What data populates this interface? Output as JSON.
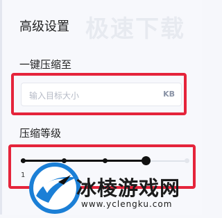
{
  "panel": {
    "title": "高级设置",
    "watermark_top": "极速下载"
  },
  "one_click": {
    "label": "一键压缩至",
    "input": {
      "placeholder": "输入目标大小",
      "value": "",
      "unit": "KB"
    }
  },
  "compression": {
    "label": "压缩等级",
    "total_steps": 5,
    "selected_step": 4,
    "first_tick_label": "1"
  },
  "watermark_brand": {
    "name": "冰棱游戏网",
    "url": "www.yclengku.com",
    "logo_icon": "ice-logo-icon"
  },
  "colors": {
    "highlight_red": "#e5243b",
    "slider_active": "#111111",
    "logo_blue": "#1b7fd6"
  }
}
